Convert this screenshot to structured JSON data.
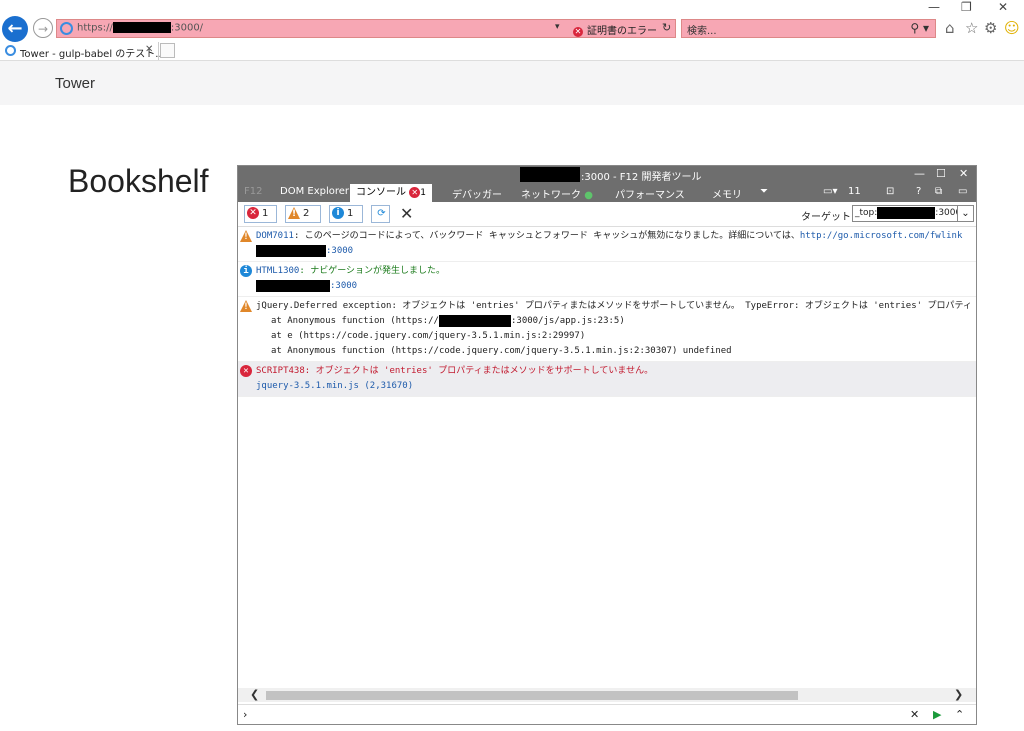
{
  "window_controls": [
    "—",
    "❐",
    "✕"
  ],
  "browser": {
    "url": "https://",
    "url_suffix": ":3000/",
    "cert_error": "証明書のエラー",
    "search_placeholder": "検索...",
    "tab_title": "Tower - gulp-babel のテスト...",
    "toolbar_icons": [
      "home-icon",
      "star-icon",
      "gear-icon",
      "smiley-icon"
    ]
  },
  "page": {
    "brand": "Tower",
    "heading": "Bookshelf"
  },
  "devtools": {
    "title": ":3000 - F12 開発者ツール",
    "tabs": {
      "f12": "F12",
      "dom": "DOM Explorer",
      "console": "コンソール",
      "console_errors": "1",
      "debugger": "デバッガー",
      "network": "ネットワーク",
      "performance": "パフォーマンス",
      "memory": "メモリ",
      "emulation_count": "11"
    },
    "filters": {
      "errors": "1",
      "warnings": "2",
      "info": "1"
    },
    "target_label": "ターゲット",
    "target_value": "_top:",
    "target_suffix": ":3000",
    "messages": [
      {
        "level": "warning",
        "code": "DOM7011",
        "text": ": このページのコードによって、バックワード キャッシュとフォワード キャッシュが無効になりました。詳細については、",
        "link": "http://go.microsoft.com/fwlink",
        "source": ":3000"
      },
      {
        "level": "info",
        "code": "HTML1300",
        "text": ": ナビゲーションが発生しました。",
        "source": ":3000"
      },
      {
        "level": "warning",
        "text": "jQuery.Deferred exception: オブジェクトは 'entries' プロパティまたはメソッドをサポートしていません。 TypeError: オブジェクトは 'entries' プロパティ",
        "stack": [
          "at Anonymous function (https://",
          ":3000/js/app.js:23:5)",
          "at e (https://code.jquery.com/jquery-3.5.1.min.js:2:29997)",
          "at Anonymous function (https://code.jquery.com/jquery-3.5.1.min.js:2:30307) undefined"
        ]
      },
      {
        "level": "error",
        "code": "SCRIPT438",
        "text": ": オブジェクトは 'entries' プロパティまたはメソッドをサポートしていません。",
        "source": "jquery-3.5.1.min.js (2,31670)"
      }
    ]
  },
  "colors": {
    "error_bar": "#f7a7b4",
    "devtools_title": "#6e6e6e",
    "error": "#d9263c",
    "warning": "#e0872a",
    "info": "#1e88d8",
    "link": "#1e5bab"
  }
}
